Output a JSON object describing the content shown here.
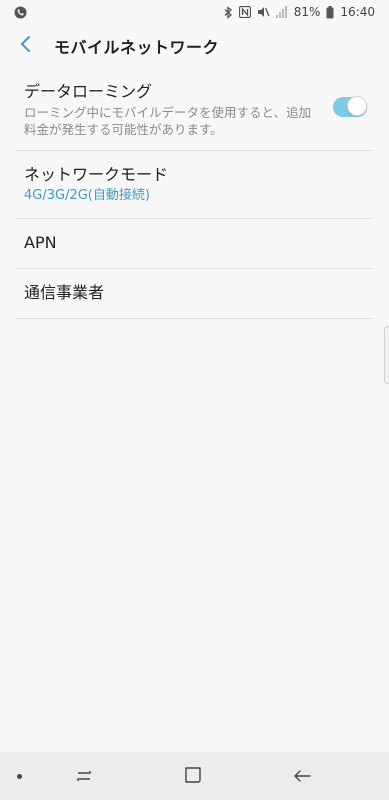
{
  "status_bar": {
    "battery_percent": "81%",
    "time": "16:40"
  },
  "header": {
    "title": "モバイルネットワーク"
  },
  "settings": {
    "data_roaming": {
      "title": "データローミング",
      "description": "ローミング中にモバイルデータを使用すると、追加料金が発生する可能性があります。",
      "enabled": true
    },
    "network_mode": {
      "title": "ネットワークモード",
      "value": "4G/3G/2G(自動接続)"
    },
    "apn": {
      "title": "APN"
    },
    "carrier": {
      "title": "通信事業者"
    }
  },
  "colors": {
    "accent": "#3e9bbd",
    "toggle_track": "#7ecbe6",
    "background": "#f8f8f8",
    "nav_bar": "#ececec"
  },
  "icons": {
    "status_left": "phone-call-icon",
    "status_right": [
      "bluetooth-icon",
      "nfc-icon",
      "mute-icon",
      "signal-icon",
      "battery-icon"
    ],
    "back": "chevron-left-icon",
    "nav": [
      "nav-dot-icon",
      "recents-icon",
      "home-icon",
      "back-arrow-icon"
    ]
  }
}
